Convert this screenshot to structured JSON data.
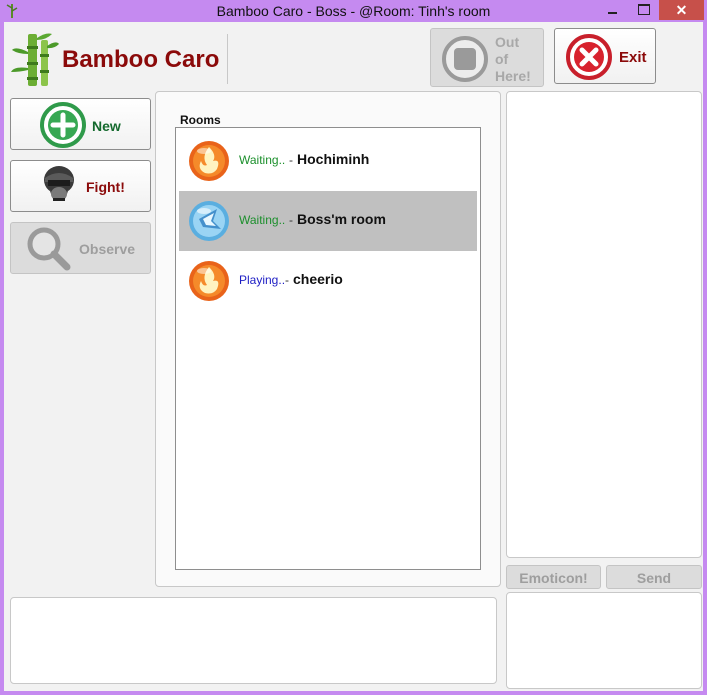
{
  "window": {
    "title": "Bamboo Caro - Boss - @Room: Tinh's room",
    "close_glyph": "✕"
  },
  "logo": {
    "text": "Bamboo Caro",
    "icon": "bamboo-icon",
    "color": "#8b0a0a"
  },
  "toolbar": {
    "out_label": "Out of Here!",
    "out_lines": [
      "Out",
      "of",
      "Here!"
    ],
    "out_icon": "stop-icon",
    "exit_label": "Exit",
    "exit_icon": "close-circle-icon"
  },
  "sidebar": {
    "new_label": "New",
    "new_icon": "plus-circle-icon",
    "fight_label": "Fight!",
    "fight_icon": "helmet-icon",
    "observe_label": "Observe",
    "observe_icon": "magnifier-icon"
  },
  "rooms": {
    "title": "Rooms",
    "items": [
      {
        "status": "Waiting..",
        "separator": "-",
        "name": "Hochiminh",
        "icon": "fire-orb-icon",
        "selected": false
      },
      {
        "status": "Waiting..",
        "separator": "-",
        "name": "Boss'm room",
        "icon": "ice-orb-icon",
        "selected": true
      },
      {
        "status": "Playing..",
        "separator": "-",
        "name": "cheerio",
        "icon": "fire-orb-icon",
        "selected": false
      }
    ]
  },
  "chat": {
    "emoticon_label": "Emoticon!",
    "send_label": "Send"
  },
  "colors": {
    "window_frame": "#c58af0",
    "waiting": "#1c8f2c",
    "playing": "#1d1dc4",
    "brand_red": "#8b0a0a",
    "new_green": "#156a2e"
  }
}
